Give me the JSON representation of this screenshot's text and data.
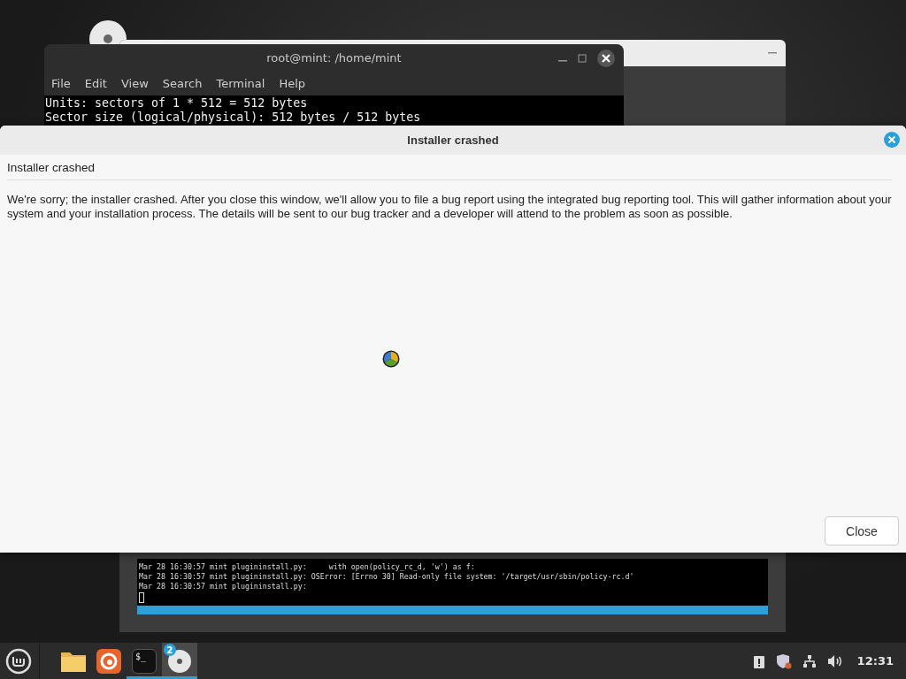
{
  "terminal": {
    "title": "root@mint: /home/mint",
    "menu": [
      "File",
      "Edit",
      "View",
      "Search",
      "Terminal",
      "Help"
    ],
    "lines": [
      "Units: sectors of 1 * 512 = 512 bytes",
      "Sector size (logical/physical): 512 bytes / 512 bytes"
    ]
  },
  "installer_window": {
    "log_lines": [
      "Mar 28 16:30:57 mint plugininstall.py:     with open(policy_rc_d, 'w') as f:",
      "Mar 28 16:30:57 mint plugininstall.py: OSError: [Errno 30] Read-only file system: '/target/usr/sbin/policy-rc.d'",
      "Mar 28 16:30:57 mint plugininstall.py:"
    ],
    "progress": {
      "level": 1
    }
  },
  "dialog": {
    "title": "Installer crashed",
    "heading": "Installer crashed",
    "message": "We're sorry; the installer crashed. After you close this window, we'll allow you to file a bug report using the integrated bug reporting tool. This will gather information about your system and your installation process. The details will be sent to our bug tracker and a developer will attend to the problem as soon as possible.",
    "buttons": [
      "Close"
    ]
  },
  "taskbar": {
    "launchers": [
      {
        "kind": "folder",
        "running": false,
        "active": false
      },
      {
        "kind": "browser",
        "running": false,
        "active": false
      },
      {
        "kind": "terminal",
        "glyph": "$_",
        "running": true,
        "active": false
      },
      {
        "kind": "disc",
        "badge": "2",
        "running": true,
        "active": true
      }
    ],
    "clock": "12:31"
  }
}
